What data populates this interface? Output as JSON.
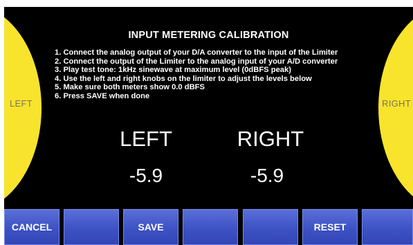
{
  "screen": {
    "title": "INPUT METERING CALIBRATION",
    "instructions": [
      "1. Connect the analog output of your D/A converter to the input of the Limiter",
      "2. Connect the output of the Limiter to the analog input of your A/D converter",
      "3. Play test tone: 1kHz sinewave at maximum level (0dBFS peak)",
      "4. Use the left and right knobs on the limiter to adjust the levels below",
      "5. Make sure both meters show 0.0 dBFS",
      "6. Press SAVE when done"
    ]
  },
  "knobs": {
    "left_label": "LEFT",
    "right_label": "RIGHT",
    "color": "#f8e42c"
  },
  "meters": {
    "left": {
      "label": "LEFT",
      "value": "-5.9"
    },
    "right": {
      "label": "RIGHT",
      "value": "-5.9"
    }
  },
  "buttons": {
    "cancel": "CANCEL",
    "blank1": "",
    "save": "SAVE",
    "blank2": "",
    "blank3": "",
    "reset": "RESET",
    "blank4": "",
    "color": "#3d52c4"
  }
}
